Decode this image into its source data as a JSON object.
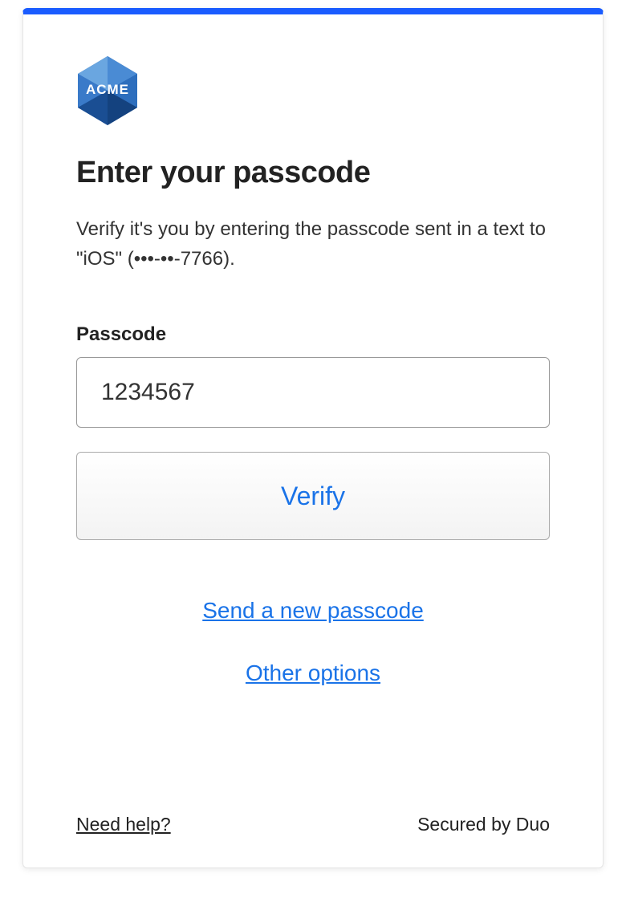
{
  "logo": {
    "text": "ACME"
  },
  "heading": "Enter your passcode",
  "instruction": "Verify it's you by entering the passcode sent in a text to \"iOS\" (•••-••-7766).",
  "passcode": {
    "label": "Passcode",
    "value": "1234567"
  },
  "verify_label": "Verify",
  "resend_label": "Send a new passcode",
  "other_options_label": "Other options",
  "help_label": "Need help?",
  "secured_label": "Secured by Duo"
}
